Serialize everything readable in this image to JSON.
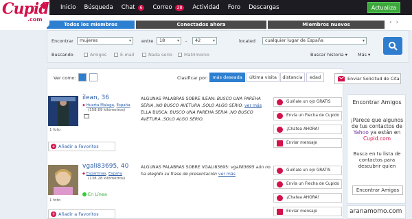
{
  "logo": {
    "text": "Cupid",
    "sub": ".com"
  },
  "nav": {
    "items": [
      "Inicio",
      "Búsqueda",
      "Chat",
      "Correo",
      "Actividad",
      "Foro",
      "Descargas"
    ],
    "chat_badge": "6",
    "correo_badge": "28",
    "activar": "Actualiza"
  },
  "tabs": [
    "Todos los miembros",
    "Conectados ahora",
    "Miembros nuevos"
  ],
  "search": {
    "encontrar_label": "Encontrar",
    "encontrar_value": "mujeres",
    "entre_label": "entre",
    "age_from": "18",
    "age_sep": "-",
    "age_to": "42",
    "located_label": "located",
    "located_value": "cualquier lugar de España",
    "buscando_label": "Buscando",
    "checks": [
      "Amigos",
      "E-mail",
      "Nada serio",
      "Matrimonio"
    ],
    "historia": "Buscar historia ▾",
    "mas": "Más ▾"
  },
  "results": {
    "ver_como": "Ver como:",
    "clasificar": "Clasificar por:",
    "sort": [
      "más deseada",
      "última visita",
      "distancia",
      "edad"
    ],
    "enviar_solicitud": "Enviar Solicitud de Cita"
  },
  "profiles": [
    {
      "name": "ilean, 36",
      "location": "Huerta Malaga",
      "country": "España",
      "distance": "(158.69 kilómetros)",
      "fotos": "1 foto",
      "about_title": "ALGUNAS PALABRAS SOBRE ILEAN:",
      "about_text": "BUSCO UNA PAREHA SERIA ,NO BUSCO AVETURA .SOLO ALGO SERIO.",
      "ver_mas": "ver más",
      "busca_title": "ELLA BUSCA:",
      "busca_text": "BUSCO UNA PAREHA SERIA ,NO BUSCO AVETURA .SOLO ALGO SERIO.",
      "fav": "Añadir a Favoritos"
    },
    {
      "name": "vgali83695, 40",
      "location": "Espartinas",
      "country": "España",
      "distance": "(138.28 kilómetros)",
      "fotos": "1 foto",
      "online": "En Línea",
      "about_title": "ALGUNAS PALABRAS SOBRE VGALI83695:",
      "about_text": "vgali83695 aún no ha elegido su frase de presentación",
      "ver_mas": "ver más",
      "fav": "Añadir a Favoritos"
    }
  ],
  "actions": [
    "Guiñale un ojo GRATIS",
    "Envía un Flecha de Cupido",
    "¡Chatea AHORA!",
    "Enviar mensaje"
  ],
  "sidebar": {
    "title": "Encontrar Amigos",
    "line1": "¡Parece que algunos de tus contactos de",
    "yahoo": "Yahoo",
    "line2": "ya están en",
    "cupid": "Cupid.com",
    "line3": "Busca en tu lista de contactos para descubrir quien",
    "button": "Encontrar Amigos"
  },
  "arana": "aranamomo.com"
}
